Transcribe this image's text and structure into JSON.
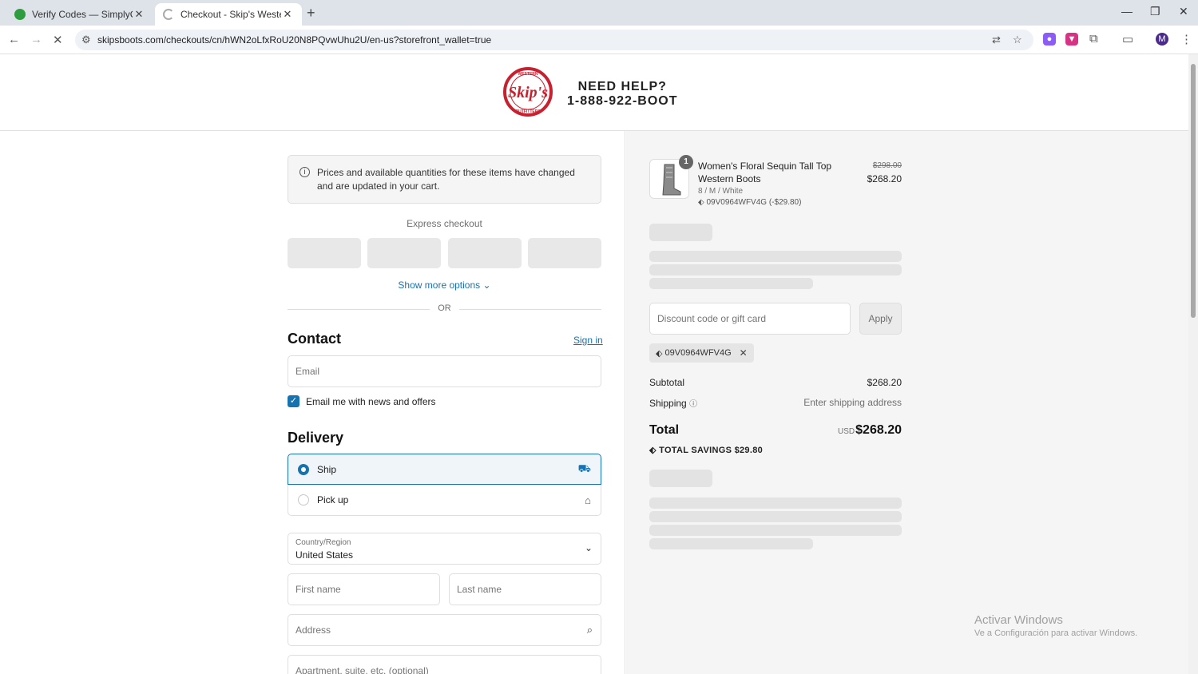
{
  "browser": {
    "tabs": [
      {
        "title": "Verify Codes — SimplyCodes",
        "favicon_color": "#2e9d3f"
      },
      {
        "title": "Checkout - Skip's Western Outf",
        "favicon_color": "#aaaaaa"
      }
    ],
    "url": "skipsboots.com/checkouts/cn/hWN2oLfxRoU20N8PQvwUhu2U/en-us?storefront_wallet=true",
    "profile_initial": "M"
  },
  "header": {
    "logo_text": "Skip's",
    "logo_ring_top": "WESTERN",
    "logo_ring_bottom": "OUTFITTERS",
    "help_line1": "NEED HELP?",
    "help_line2": "1-888-922-BOOT"
  },
  "notice": "Prices and available quantities for these items have changed and are updated in your cart.",
  "express": {
    "label": "Express checkout",
    "show_more": "Show more options",
    "or": "OR"
  },
  "contact": {
    "heading": "Contact",
    "sign_in": "Sign in",
    "email_placeholder": "Email",
    "newsletter_label": "Email me with news and offers",
    "newsletter_checked": true
  },
  "delivery": {
    "heading": "Delivery",
    "options": [
      {
        "label": "Ship",
        "selected": true,
        "icon": "truck-icon"
      },
      {
        "label": "Pick up",
        "selected": false,
        "icon": "store-icon"
      }
    ],
    "country_label": "Country/Region",
    "country_value": "United States",
    "first_name_placeholder": "First name",
    "last_name_placeholder": "Last name",
    "address_placeholder": "Address",
    "apartment_placeholder": "Apartment, suite, etc. (optional)"
  },
  "summary": {
    "item": {
      "quantity": "1",
      "name": "Women's Floral Sequin Tall Top Western Boots",
      "variant": "8 / M / White",
      "discount": "09V0964WFV4G (-$29.80)",
      "original_price": "$298.00",
      "price": "$268.20"
    },
    "discount_placeholder": "Discount code or gift card",
    "apply_label": "Apply",
    "applied_code": "09V0964WFV4G",
    "subtotal_label": "Subtotal",
    "subtotal_value": "$268.20",
    "shipping_label": "Shipping",
    "shipping_value": "Enter shipping address",
    "total_label": "Total",
    "total_currency": "USD",
    "total_value": "$268.20",
    "savings_label": "TOTAL SAVINGS",
    "savings_value": "$29.80"
  },
  "watermark": {
    "line1": "Activar Windows",
    "line2": "Ve a Configuración para activar Windows."
  },
  "colors": {
    "accent": "#1773b0",
    "brand_red": "#c8202f"
  }
}
